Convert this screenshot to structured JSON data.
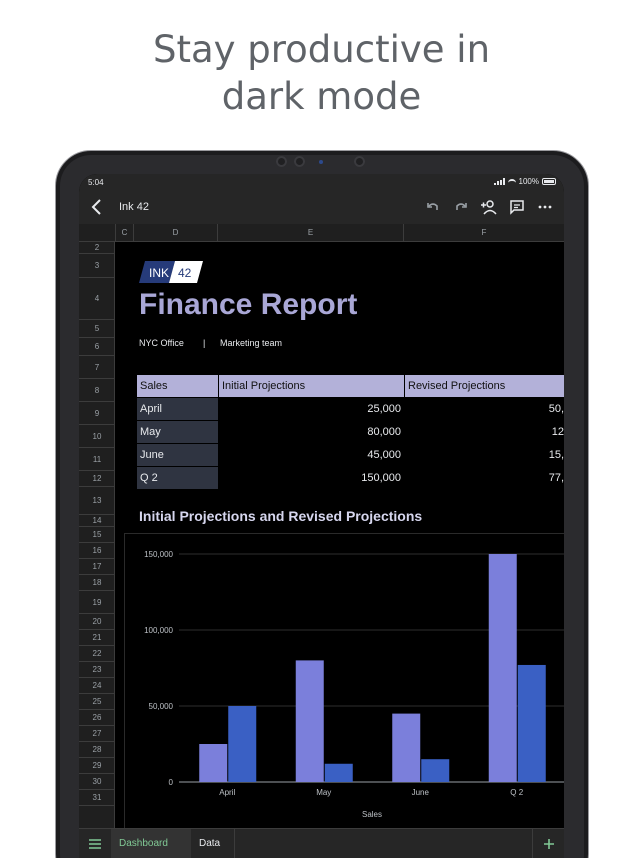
{
  "headline": {
    "line1": "Stay productive in",
    "line2": "dark mode"
  },
  "status": {
    "time": "5:04",
    "battery": "100%"
  },
  "appbar": {
    "title": "Ink 42"
  },
  "columns": [
    "C",
    "D",
    "E",
    "F"
  ],
  "rows": [
    "2",
    "3",
    "4",
    "5",
    "6",
    "7",
    "8",
    "9",
    "10",
    "11",
    "12",
    "13",
    "14",
    "15",
    "16",
    "17",
    "18",
    "19",
    "20",
    "21",
    "22",
    "23",
    "24",
    "25",
    "26",
    "27",
    "28",
    "29",
    "30",
    "31"
  ],
  "logo": {
    "left": "INK",
    "right": "42"
  },
  "report": {
    "title": "Finance Report",
    "office": "NYC Office",
    "separator": "|",
    "team": "Marketing team"
  },
  "table": {
    "headers": [
      "Sales",
      "Initial Projections",
      "Revised Projections"
    ],
    "rows": [
      {
        "label": "April",
        "initial": "25,000",
        "revised": "50,"
      },
      {
        "label": "May",
        "initial": "80,000",
        "revised": "12"
      },
      {
        "label": "June",
        "initial": "45,000",
        "revised": "15,"
      },
      {
        "label": "Q 2",
        "initial": "150,000",
        "revised": "77,"
      }
    ]
  },
  "chart_data": {
    "type": "bar",
    "title": "Initial Projections and Revised Projections",
    "xlabel": "Sales",
    "ylabel": "",
    "categories": [
      "April",
      "May",
      "June",
      "Q 2"
    ],
    "series": [
      {
        "name": "Initial Projections",
        "values": [
          25000,
          80000,
          45000,
          150000
        ],
        "color": "#7b7fdb"
      },
      {
        "name": "Revised Projections",
        "values": [
          50000,
          12000,
          15000,
          77000
        ],
        "color": "#3a60c4"
      }
    ],
    "ylim": [
      0,
      150000
    ],
    "yticks": [
      0,
      50000,
      100000,
      150000
    ],
    "ytick_labels": [
      "0",
      "50,000",
      "100,000",
      "150,000"
    ],
    "grid": true
  },
  "tabs": {
    "active": "Dashboard",
    "inactive": "Data"
  },
  "colors": {
    "accent": "#81c995",
    "header_fill": "#b3b1d9",
    "title": "#a9a7d6"
  }
}
